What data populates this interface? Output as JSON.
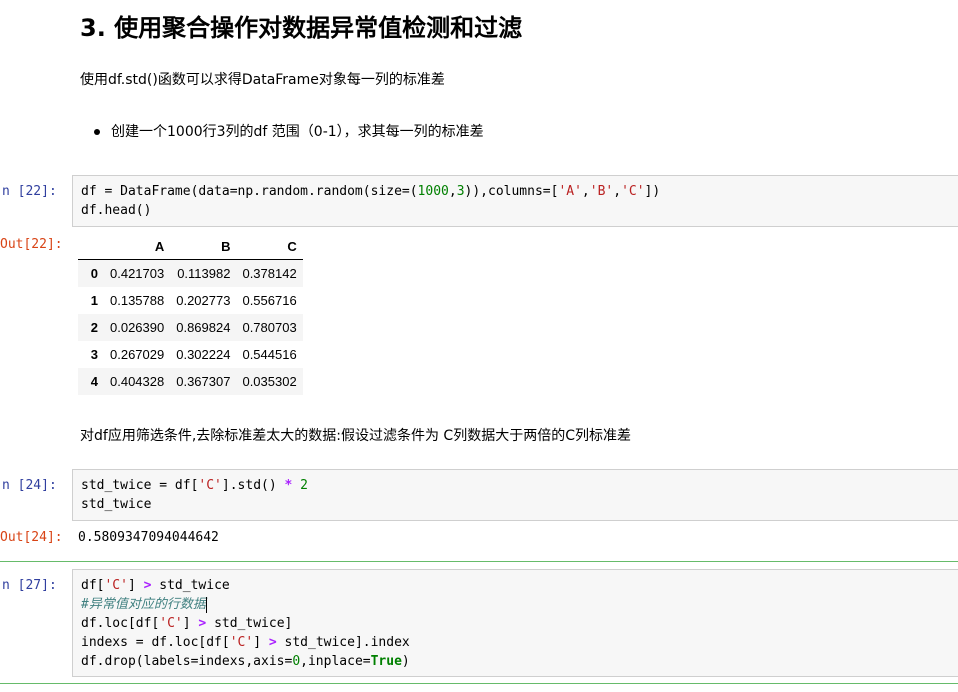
{
  "heading": "3. 使用聚合操作对数据异常值检测和过滤",
  "intro": "使用df.std()函数可以求得DataFrame对象每一列的标准差",
  "bullet": "创建一个1000行3列的df 范围（0-1），求其每一列的标准差",
  "cell22": {
    "in_prompt": "n  [22]:",
    "out_prompt": "Out[22]:",
    "table": {
      "columns": [
        "",
        "A",
        "B",
        "C"
      ],
      "rows": [
        {
          "index": "0",
          "A": "0.421703",
          "B": "0.113982",
          "C": "0.378142"
        },
        {
          "index": "1",
          "A": "0.135788",
          "B": "0.202773",
          "C": "0.556716"
        },
        {
          "index": "2",
          "A": "0.026390",
          "B": "0.869824",
          "C": "0.780703"
        },
        {
          "index": "3",
          "A": "0.267029",
          "B": "0.302224",
          "C": "0.544516"
        },
        {
          "index": "4",
          "A": "0.404328",
          "B": "0.367307",
          "C": "0.035302"
        }
      ]
    }
  },
  "filter_text": "对df应用筛选条件,去除标准差太大的数据:假设过滤条件为 C列数据大于两倍的C列标准差",
  "cell24": {
    "in_prompt": "n  [24]:",
    "out_prompt": "Out[24]:",
    "output": "0.5809347094044642"
  },
  "cell27": {
    "in_prompt": "n  [27]:"
  },
  "code": {
    "c22_l1_a": "df = DataFrame(data=np.random.random(size=(",
    "c22_l1_n1": "1000",
    "c22_l1_b": ",",
    "c22_l1_n2": "3",
    "c22_l1_c": ")),columns=[",
    "c22_l1_s1": "'A'",
    "c22_l1_d": ",",
    "c22_l1_s2": "'B'",
    "c22_l1_e": ",",
    "c22_l1_s3": "'C'",
    "c22_l1_f": "])",
    "c22_l2": "df.head()",
    "c24_l1_a": "std_twice = df[",
    "c24_l1_s": "'C'",
    "c24_l1_b": "].std() ",
    "c24_l1_o": "*",
    "c24_l1_c": " ",
    "c24_l1_n": "2",
    "c24_l2": "std_twice",
    "c27_l1_a": "df[",
    "c27_l1_s": "'C'",
    "c27_l1_b": "] ",
    "c27_l1_o": ">",
    "c27_l1_c": " std_twice",
    "c27_l2_comment": "#异常值对应的行数据",
    "c27_l3_a": "df.loc[df[",
    "c27_l3_s": "'C'",
    "c27_l3_b": "] ",
    "c27_l3_o": ">",
    "c27_l3_c": " std_twice]",
    "c27_l4_a": "indexs = df.loc[df[",
    "c27_l4_s": "'C'",
    "c27_l4_b": "] ",
    "c27_l4_o": ">",
    "c27_l4_c": " std_twice].index",
    "c27_l5_a": "df.drop(labels=indexs,axis=",
    "c27_l5_n": "0",
    "c27_l5_b": ",inplace=",
    "c27_l5_k": "True",
    "c27_l5_c": ")"
  },
  "colors": {
    "in_prompt": "#303f9f",
    "out_prompt": "#d84315",
    "selected_cell_border": "#66bb6a"
  }
}
